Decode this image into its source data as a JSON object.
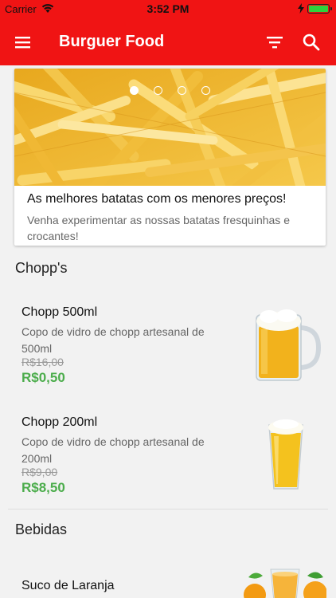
{
  "status_bar": {
    "carrier": "Carrier",
    "time": "3:52 PM"
  },
  "app_bar": {
    "title": "Burguer Food"
  },
  "banner": {
    "title": "As melhores batatas com os menores preços!",
    "description": "Venha experimentar as nossas batatas fresquinhas e crocantes!",
    "slide_count": 4,
    "active_slide": 1
  },
  "sections": [
    {
      "title": "Chopp's",
      "products": [
        {
          "name": "Chopp 500ml",
          "description": "Copo de vidro de chopp artesanal de 500ml",
          "old_price": "R$16,00",
          "price": "R$0,50"
        },
        {
          "name": "Chopp 200ml",
          "description": "Copo de vidro de chopp artesanal de 200ml",
          "old_price": "R$9,00",
          "price": "R$8,50"
        }
      ]
    },
    {
      "title": "Bebidas",
      "products": [
        {
          "name": "Suco de Laranja"
        }
      ]
    }
  ],
  "colors": {
    "primary": "#f01414",
    "price": "#4cad4c"
  }
}
